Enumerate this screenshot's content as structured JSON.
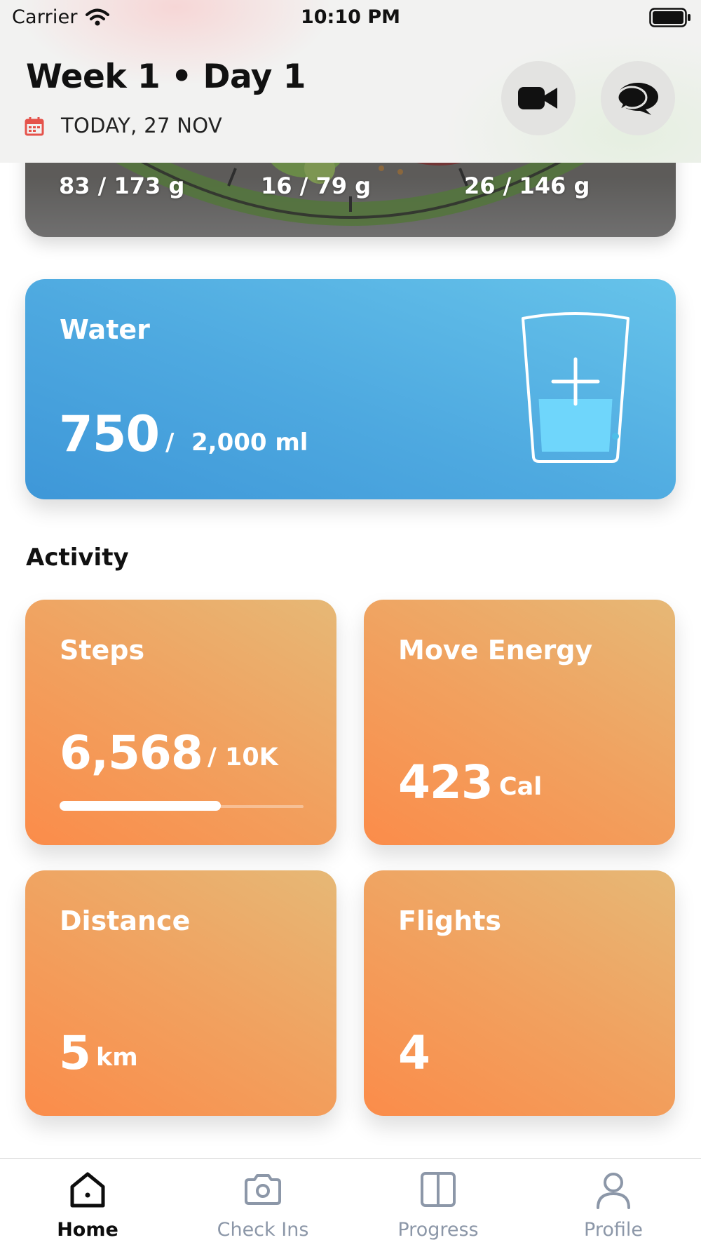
{
  "status_bar": {
    "carrier": "Carrier",
    "time": "10:10 PM",
    "icons": [
      "wifi-icon",
      "battery-icon"
    ]
  },
  "header": {
    "title": "Week 1 • Day 1",
    "date": "TODAY, 27 NOV",
    "calendar_icon": "calendar-icon",
    "calendar_color": "#e5534b",
    "video_icon": "video-camera-icon",
    "chat_icon": "chat-bubbles-icon"
  },
  "macros": {
    "items": [
      "83 / 173 g",
      "16 / 79 g",
      "26 / 146 g"
    ]
  },
  "water": {
    "title": "Water",
    "value": "750",
    "separator": "/",
    "goal": "2,000 ml",
    "fill_fraction": 0.375,
    "add_icon": "add-water-glass-icon",
    "color": "#4ea9e0"
  },
  "activity": {
    "title": "Activity",
    "steps": {
      "title": "Steps",
      "value": "6,568",
      "goal": "/ 10K",
      "progress": 0.66
    },
    "move_energy": {
      "title": "Move Energy",
      "value": "423",
      "unit": "Cal"
    },
    "distance": {
      "title": "Distance",
      "value": "5",
      "unit": "km"
    },
    "flights": {
      "title": "Flights",
      "value": "4"
    },
    "tile_color": "#f29b57"
  },
  "tab_bar": {
    "tabs": [
      {
        "label": "Home",
        "icon": "home-icon",
        "active": true
      },
      {
        "label": "Check Ins",
        "icon": "camera-icon",
        "active": false
      },
      {
        "label": "Progress",
        "icon": "progress-icon",
        "active": false
      },
      {
        "label": "Profile",
        "icon": "profile-icon",
        "active": false
      }
    ],
    "active_color": "#0d0d0d",
    "inactive_color": "#8c97a8"
  }
}
